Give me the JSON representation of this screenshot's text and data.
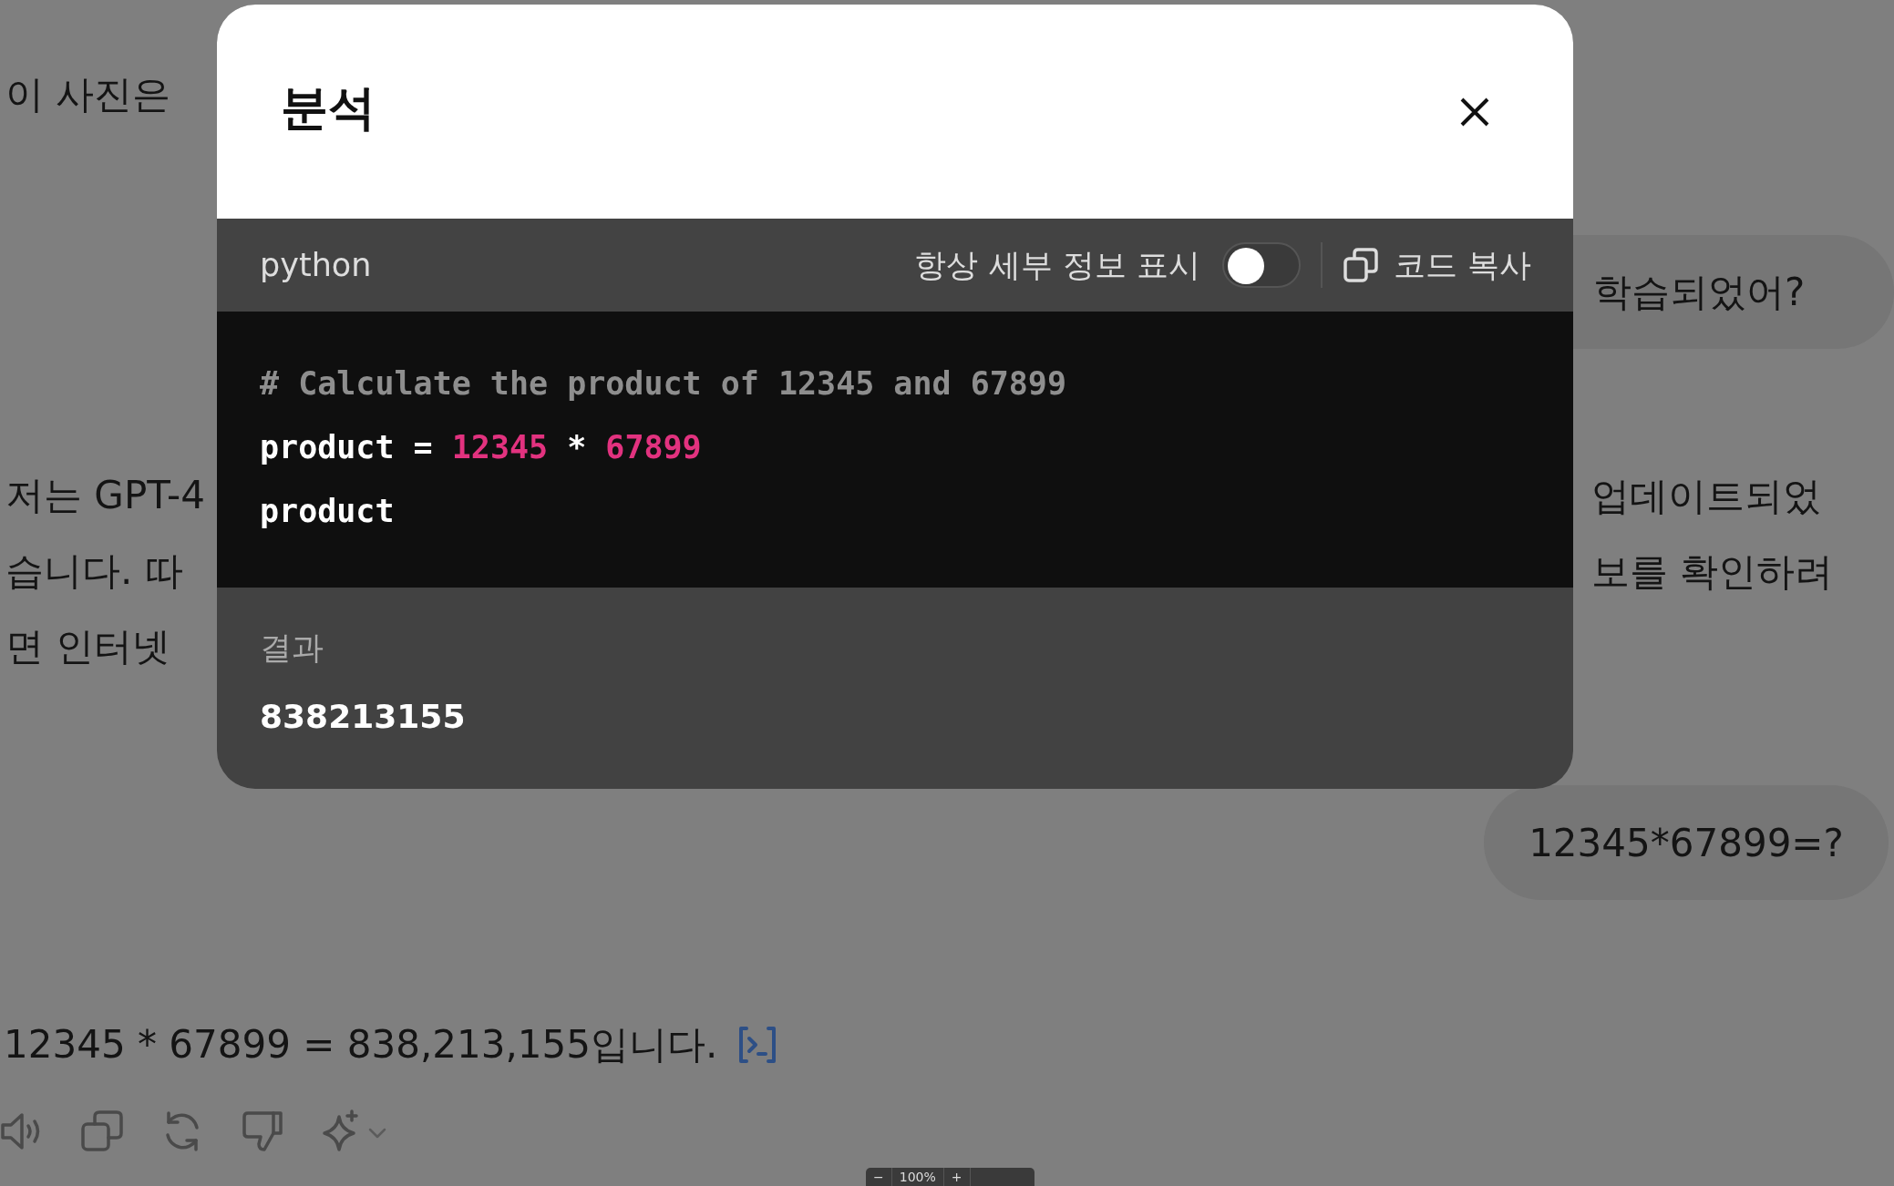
{
  "background": {
    "left_lines": [
      "이 사진은",
      "저는 GPT-4",
      "습니다. 따",
      "면 인터넷"
    ],
    "bubble_fragment": "학습되었어?",
    "right_lines": [
      "업데이트되었",
      "보를 확인하려"
    ],
    "user_message": "12345*67899=?",
    "answer": "12345 * 67899 = 838,213,155입니다."
  },
  "dialog": {
    "title": "분석",
    "language": "python",
    "details_label": "항상 세부 정보 표시",
    "details_toggle": {
      "on": false
    },
    "copy_label": "코드 복사",
    "code_lines": [
      [
        {
          "kind": "comment",
          "text": "# Calculate the product of 12345 and 67899"
        }
      ],
      [
        {
          "kind": "name",
          "text": "product"
        },
        {
          "kind": "op",
          "text": " = "
        },
        {
          "kind": "number",
          "text": "12345"
        },
        {
          "kind": "op",
          "text": " * "
        },
        {
          "kind": "number",
          "text": "67899"
        }
      ],
      [
        {
          "kind": "name",
          "text": "product"
        }
      ]
    ],
    "result_label": "결과",
    "result_value": "838213155"
  },
  "zoom_bar": {
    "minus": "−",
    "reading": "100%",
    "plus": "+"
  }
}
